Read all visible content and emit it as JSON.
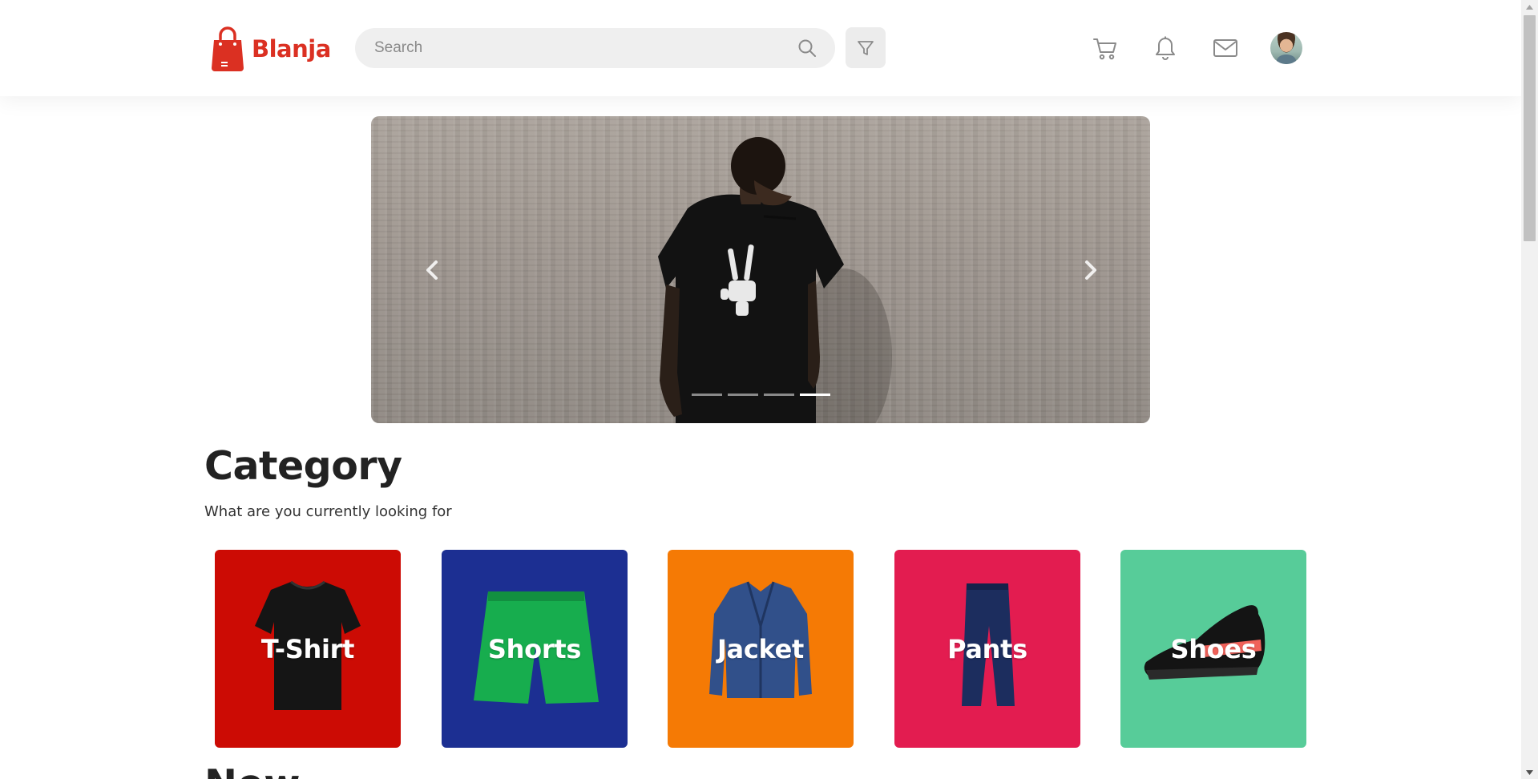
{
  "brand": {
    "name": "Blanja",
    "accent": "#db3022"
  },
  "search": {
    "placeholder": "Search",
    "icon": "search-icon"
  },
  "header_icons": [
    "filter-icon",
    "cart-icon",
    "bell-icon",
    "mail-icon"
  ],
  "carousel": {
    "slide_count": 4,
    "active_index": 3
  },
  "category": {
    "title": "Category",
    "subtitle": "What are you currently looking for",
    "items": [
      {
        "label": "T-Shirt",
        "color": "#cc0b04"
      },
      {
        "label": "Shorts",
        "color": "#1c2f92"
      },
      {
        "label": "Jacket",
        "color": "#f57a05"
      },
      {
        "label": "Pants",
        "color": "#e31c50"
      },
      {
        "label": "Shoes",
        "color": "#57cc99"
      }
    ]
  },
  "new_section": {
    "title": "New"
  }
}
